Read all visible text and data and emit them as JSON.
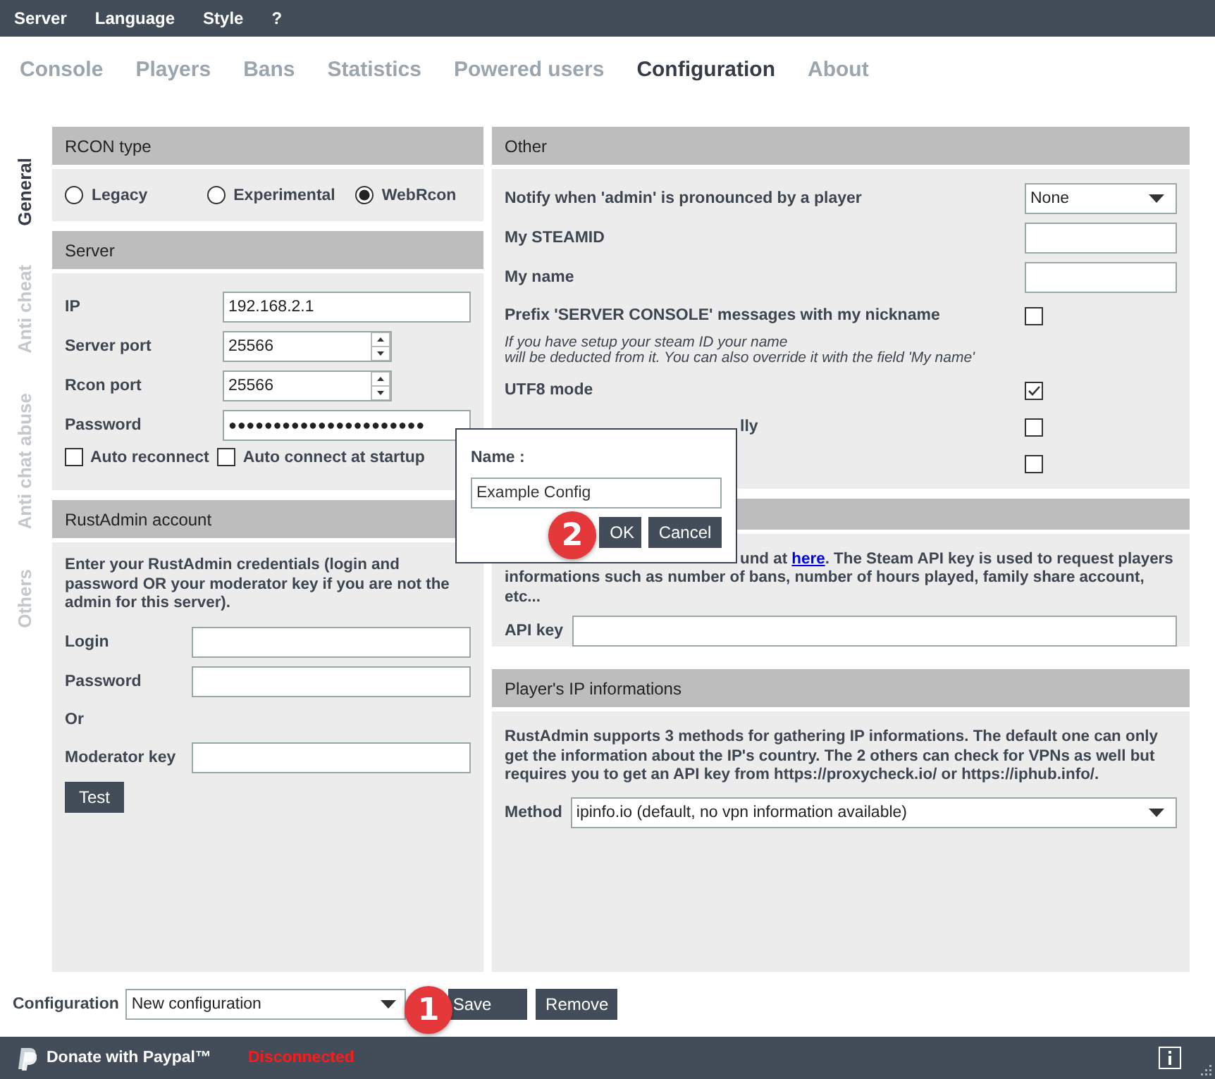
{
  "menu": [
    "Server",
    "Language",
    "Style",
    "?"
  ],
  "tabs": [
    {
      "label": "Console",
      "selected": false
    },
    {
      "label": "Players",
      "selected": false
    },
    {
      "label": "Bans",
      "selected": false
    },
    {
      "label": "Statistics",
      "selected": false
    },
    {
      "label": "Powered users",
      "selected": false
    },
    {
      "label": "Configuration",
      "selected": true
    },
    {
      "label": "About",
      "selected": false
    }
  ],
  "side_tabs": [
    {
      "label": "General",
      "selected": true
    },
    {
      "label": "Anti cheat",
      "selected": false
    },
    {
      "label": "Anti chat abuse",
      "selected": false
    },
    {
      "label": "Others",
      "selected": false
    }
  ],
  "rcon_type": {
    "title": "RCON type",
    "options": [
      {
        "label": "Legacy",
        "selected": false
      },
      {
        "label": "Experimental",
        "selected": false
      },
      {
        "label": "WebRcon",
        "selected": true
      }
    ]
  },
  "server": {
    "title": "Server",
    "fields": [
      {
        "kind": "text",
        "label": "IP",
        "value": "192.168.2.1"
      },
      {
        "kind": "spin",
        "label": "Server port",
        "value": "25566"
      },
      {
        "kind": "spin",
        "label": "Rcon port",
        "value": "25566"
      },
      {
        "kind": "password",
        "label": "Password",
        "value": "●●●●●●●●●●●●●●●●●●●●●●"
      }
    ],
    "checkboxes": [
      {
        "label": "Auto reconnect",
        "checked": false
      },
      {
        "label": "Auto connect at startup",
        "checked": false
      }
    ]
  },
  "account": {
    "title": "RustAdmin account",
    "description": "Enter your RustAdmin credentials (login and password OR your moderator key if you are not the admin for this server).",
    "rows": [
      {
        "kind": "field",
        "label": "Login"
      },
      {
        "kind": "field",
        "label": "Password"
      },
      {
        "kind": "text",
        "label": "Or"
      },
      {
        "kind": "field",
        "label": "Moderator key"
      }
    ],
    "button": "Test"
  },
  "other": {
    "title": "Other",
    "rows": [
      {
        "kind": "select",
        "label": "Notify when 'admin' is pronounced by a player",
        "value": "None"
      },
      {
        "kind": "input",
        "label": "My STEAMID"
      },
      {
        "kind": "input",
        "label": "My name"
      },
      {
        "kind": "checkbox",
        "label": "Prefix 'SERVER CONSOLE' messages with my nickname",
        "checked": false
      },
      {
        "kind": "note",
        "label": "If you have setup your steam ID your name\nwill be deducted from it. You can also override it with the field 'My name'"
      },
      {
        "kind": "checkbox",
        "label": "UTF8 mode",
        "checked": true
      },
      {
        "kind": "partial_checkbox",
        "label": "lly",
        "checked": false
      },
      {
        "kind": "partial_checkbox",
        "checked": false
      }
    ]
  },
  "steam": {
    "text_before": "und at ",
    "link": "here",
    "text_after": ". The Steam API key is used to request players informations such as number of bans, number of hours played, family share account, etc...",
    "field_label": "API key"
  },
  "ip_info": {
    "title": "Player's IP informations",
    "description": "RustAdmin supports 3 methods for gathering IP informations. The default one can only get the information about the IP's country. The 2 others can check for VPNs as well but requires you to get an API key from https://proxycheck.io/ or https://iphub.info/.",
    "method_label": "Method",
    "method_value": "ipinfo.io (default, no vpn information available)"
  },
  "configuration": {
    "label": "Configuration",
    "value": "New configuration",
    "buttons": [
      "Save",
      "Remove"
    ]
  },
  "dialog": {
    "label": "Name :",
    "value": "Example Config",
    "buttons": [
      "OK",
      "Cancel"
    ]
  },
  "callouts": [
    "1",
    "2"
  ],
  "status_bar": {
    "donate": "Donate with Paypal™",
    "connection": "Disconnected"
  }
}
